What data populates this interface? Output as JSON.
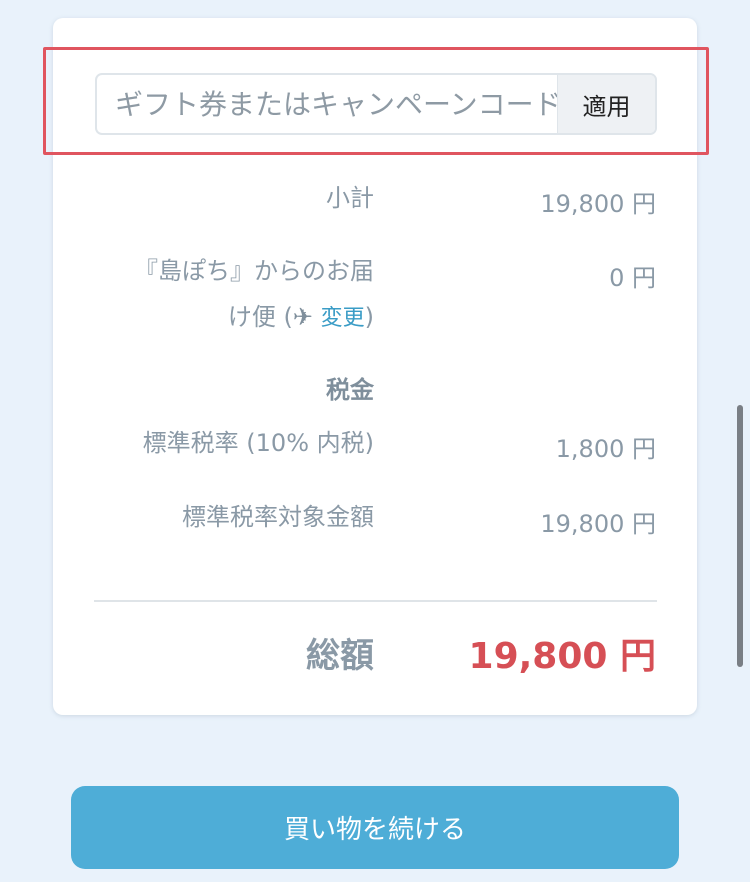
{
  "coupon": {
    "placeholder": "ギフト券またはキャンペーンコード",
    "apply_label": "適用"
  },
  "summary": {
    "subtotal_label": "小計",
    "subtotal_value": "19,800 円",
    "shipping_label_line1": "『島ぽち』からのお届",
    "shipping_label_line2_prefix": "け便 (",
    "shipping_plane_icon": "✈",
    "shipping_change_link": "変更",
    "shipping_label_line2_suffix": ")",
    "shipping_value": "0 円",
    "tax_heading": "税金",
    "tax_rate_label": "標準税率 (10% 内税)",
    "tax_rate_value": "1,800 円",
    "tax_base_label": "標準税率対象金額",
    "tax_base_value": "19,800 円",
    "total_label": "総額",
    "total_value": "19,800 円"
  },
  "actions": {
    "continue_label": "買い物を続ける"
  },
  "colors": {
    "accent": "#4eadd7",
    "total": "#d64f55",
    "highlight": "#e0555f"
  }
}
